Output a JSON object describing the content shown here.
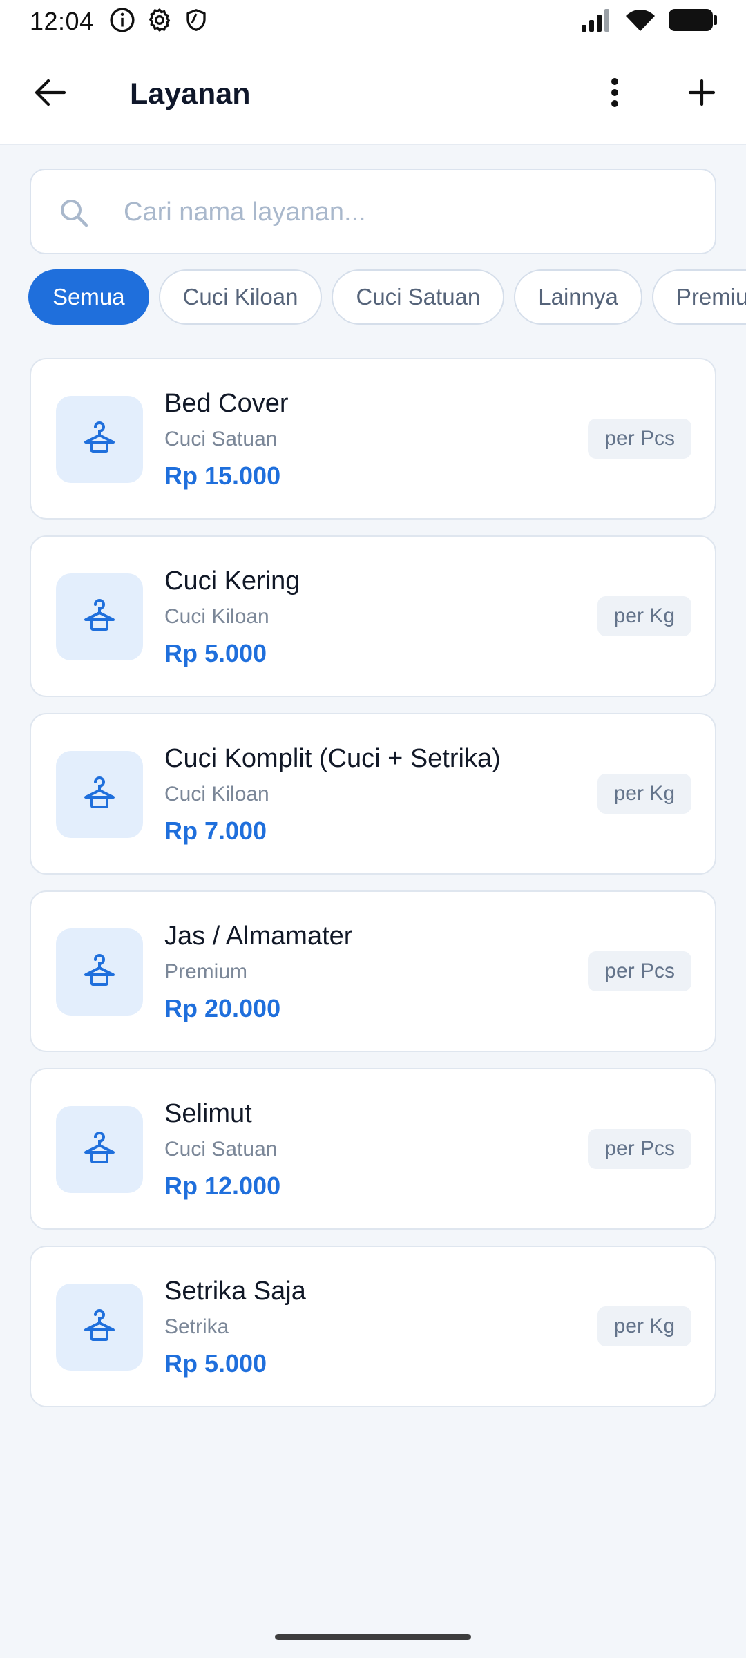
{
  "status_bar": {
    "time": "12:04",
    "icons": [
      "info-icon",
      "gear-icon",
      "shield-icon",
      "signal-icon",
      "wifi-icon",
      "battery-icon"
    ]
  },
  "app_bar": {
    "title": "Layanan",
    "icons": [
      "back-arrow-icon",
      "more-vertical-icon",
      "plus-icon"
    ]
  },
  "search": {
    "placeholder": "Cari nama layanan...",
    "value": ""
  },
  "filters": {
    "selected": "Semua",
    "chips": [
      {
        "label": "Semua",
        "active": true
      },
      {
        "label": "Cuci Kiloan",
        "active": false
      },
      {
        "label": "Cuci Satuan",
        "active": false
      },
      {
        "label": "Lainnya",
        "active": false
      },
      {
        "label": "Premium",
        "active": false
      }
    ]
  },
  "services": [
    {
      "name": "Bed Cover",
      "category": "Cuci Satuan",
      "price": "Rp 15.000",
      "unit": "per Pcs",
      "icon": "hanger-icon"
    },
    {
      "name": "Cuci Kering",
      "category": "Cuci Kiloan",
      "price": "Rp 5.000",
      "unit": "per Kg",
      "icon": "hanger-icon"
    },
    {
      "name": "Cuci Komplit (Cuci + Setrika)",
      "category": "Cuci Kiloan",
      "price": "Rp 7.000",
      "unit": "per Kg",
      "icon": "hanger-icon"
    },
    {
      "name": "Jas / Almamater",
      "category": "Premium",
      "price": "Rp 20.000",
      "unit": "per Pcs",
      "icon": "hanger-icon"
    },
    {
      "name": "Selimut",
      "category": "Cuci Satuan",
      "price": "Rp 12.000",
      "unit": "per Pcs",
      "icon": "hanger-icon"
    },
    {
      "name": "Setrika Saja",
      "category": "Setrika",
      "price": "Rp 5.000",
      "unit": "per Kg",
      "icon": "hanger-icon"
    }
  ],
  "colors": {
    "accent": "#1f6fdc",
    "background": "#f3f6fa",
    "icon_tile": "#e3eefc"
  }
}
